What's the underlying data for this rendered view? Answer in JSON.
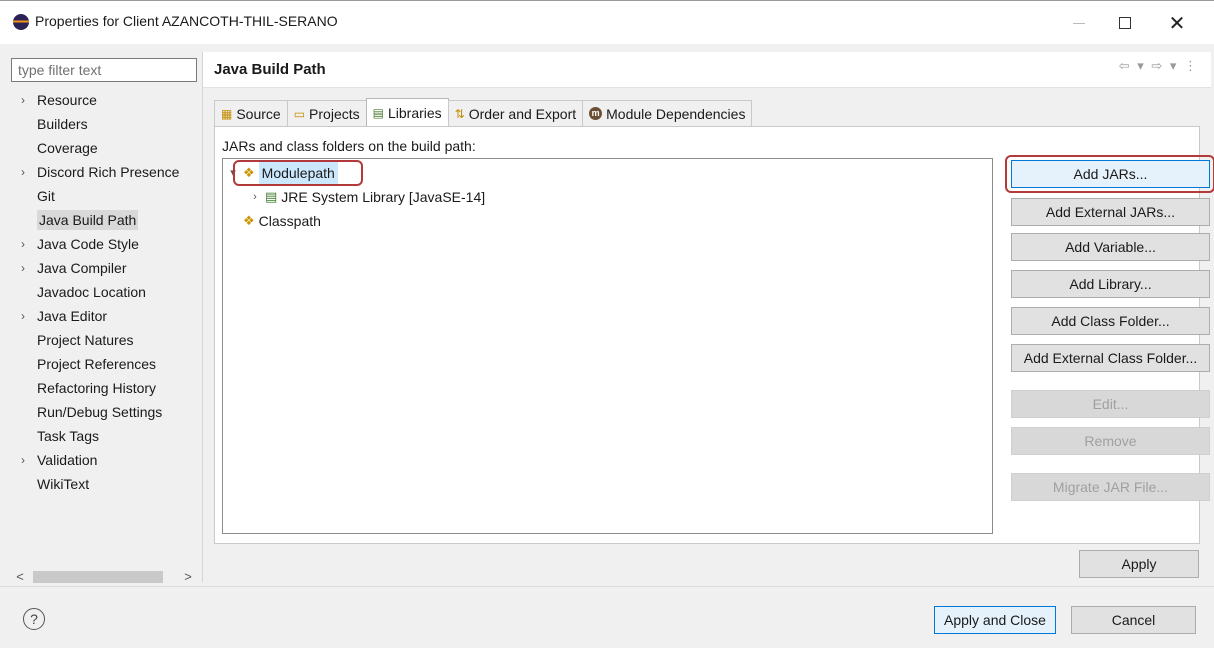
{
  "window": {
    "title": "Properties for Client AZANCOTH-THIL-SERANO",
    "minimize": "—",
    "close": "✕"
  },
  "filter": {
    "placeholder": "type filter text"
  },
  "nav": {
    "items": [
      {
        "label": "Resource",
        "expandable": true
      },
      {
        "label": "Builders",
        "expandable": false
      },
      {
        "label": "Coverage",
        "expandable": false
      },
      {
        "label": "Discord Rich Presence",
        "expandable": true
      },
      {
        "label": "Git",
        "expandable": false
      },
      {
        "label": "Java Build Path",
        "expandable": false,
        "selected": true
      },
      {
        "label": "Java Code Style",
        "expandable": true
      },
      {
        "label": "Java Compiler",
        "expandable": true
      },
      {
        "label": "Javadoc Location",
        "expandable": false
      },
      {
        "label": "Java Editor",
        "expandable": true
      },
      {
        "label": "Project Natures",
        "expandable": false
      },
      {
        "label": "Project References",
        "expandable": false
      },
      {
        "label": "Refactoring History",
        "expandable": false
      },
      {
        "label": "Run/Debug Settings",
        "expandable": false
      },
      {
        "label": "Task Tags",
        "expandable": false
      },
      {
        "label": "Validation",
        "expandable": true
      },
      {
        "label": "WikiText",
        "expandable": false
      }
    ],
    "chevron": "›",
    "scroll_left": "<",
    "scroll_right": ">"
  },
  "page": {
    "title": "Java Build Path",
    "history_nav": "⇦ ▾ ⇨ ▾ ⋮"
  },
  "tabs": [
    {
      "label": "Source",
      "icon": "source-icon"
    },
    {
      "label": "Projects",
      "icon": "projects-icon"
    },
    {
      "label": "Libraries",
      "icon": "libraries-icon",
      "active": true
    },
    {
      "label": "Order and Export",
      "icon": "order-export-icon"
    },
    {
      "label": "Module Dependencies",
      "icon": "module-dependencies-icon"
    }
  ],
  "libraries": {
    "description": "JARs and class folders on the build path:",
    "tree": {
      "modulepath": "Modulepath",
      "jre": "JRE System Library [JavaSE-14]",
      "classpath": "Classpath"
    },
    "buttons": {
      "add_jars": "Add JARs...",
      "add_external_jars": "Add External JARs...",
      "add_variable": "Add Variable...",
      "add_library": "Add Library...",
      "add_class_folder": "Add Class Folder...",
      "add_external_class_folder": "Add External Class Folder...",
      "edit": "Edit...",
      "remove": "Remove",
      "migrate_jar": "Migrate JAR File..."
    }
  },
  "footer": {
    "apply": "Apply",
    "apply_and_close": "Apply and Close",
    "cancel": "Cancel",
    "help": "?"
  },
  "colors": {
    "highlight_outline": "#b33a3a",
    "selection": "#cce8ff",
    "primary_border": "#0078d7"
  }
}
